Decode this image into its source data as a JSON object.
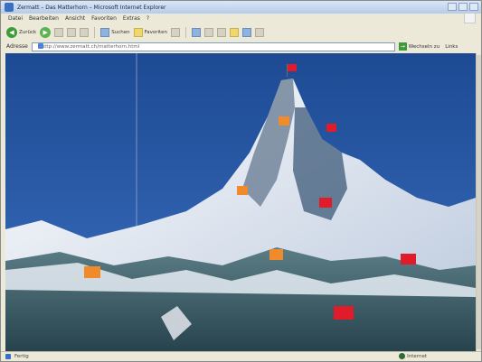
{
  "window": {
    "title": "Zermatt – Das Matterhorn – Microsoft Internet Explorer"
  },
  "menu": [
    "Datei",
    "Bearbeiten",
    "Ansicht",
    "Favoriten",
    "Extras",
    "?"
  ],
  "toolbar": {
    "back_label": "Zurück",
    "search_label": "Suchen",
    "favorites_label": "Favoriten"
  },
  "address": {
    "label": "Adresse",
    "value": "http://www.zermatt.ch/matterhorn.html",
    "go_label": "Wechseln zu",
    "links_label": "Links"
  },
  "status": {
    "text": "Fertig",
    "zone": "Internet"
  },
  "colors": {
    "sky": "#2a5aa8",
    "summit_flag": "#e01c2a",
    "marker_orange": "#f08a2a",
    "marker_red": "#e01c2a"
  },
  "markers": [
    {
      "name": "summit-flag",
      "kind": "flag-red"
    },
    {
      "name": "hut-marker-1",
      "kind": "orange"
    },
    {
      "name": "hut-marker-2",
      "kind": "red"
    },
    {
      "name": "hut-marker-3",
      "kind": "orange"
    },
    {
      "name": "hut-marker-4",
      "kind": "red"
    },
    {
      "name": "hut-marker-5",
      "kind": "orange"
    },
    {
      "name": "hut-marker-6",
      "kind": "red"
    },
    {
      "name": "hut-marker-7",
      "kind": "orange"
    },
    {
      "name": "hut-marker-8",
      "kind": "red"
    }
  ]
}
